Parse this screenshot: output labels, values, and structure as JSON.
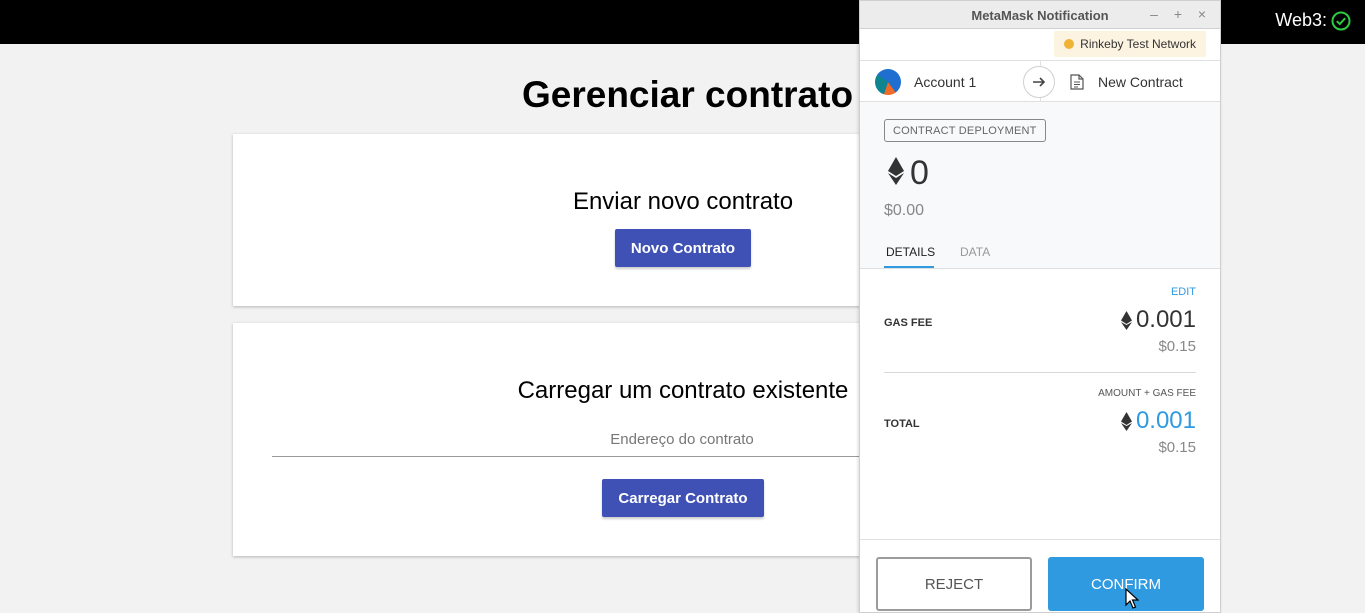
{
  "topbar": {
    "web3_label": "Web3:",
    "web3_status_icon": "check-circle-icon",
    "web3_status_color": "#2ecc40"
  },
  "page": {
    "title": "Gerenciar contrato",
    "new_contract_card": {
      "heading": "Enviar novo contrato",
      "button_label": "Novo Contrato"
    },
    "load_contract_card": {
      "heading": "Carregar um contrato existente",
      "address_placeholder": "Endereço do contrato",
      "address_value": "",
      "button_label": "Carregar Contrato"
    },
    "primary_color": "#3f51b5"
  },
  "metamask": {
    "window_title": "MetaMask Notification",
    "window_controls": {
      "minimize": "–",
      "maximize": "+",
      "close": "×"
    },
    "network": {
      "label": "Rinkeby Test Network",
      "dot_color": "#f0b336"
    },
    "from_account": "Account 1",
    "to_label": "New Contract",
    "badge": "CONTRACT DEPLOYMENT",
    "amount_eth": "0",
    "amount_usd": "$0.00",
    "tabs": [
      {
        "label": "DETAILS",
        "active": true
      },
      {
        "label": "DATA",
        "active": false
      }
    ],
    "details": {
      "edit_label": "EDIT",
      "gas_fee_label": "GAS FEE",
      "gas_fee_eth": "0.001",
      "gas_fee_usd": "$0.15",
      "amount_gas_label": "AMOUNT + GAS FEE",
      "total_label": "TOTAL",
      "total_eth": "0.001",
      "total_usd": "$0.15"
    },
    "buttons": {
      "reject": "REJECT",
      "confirm": "CONFIRM"
    },
    "accent_color": "#2f9ae0"
  }
}
